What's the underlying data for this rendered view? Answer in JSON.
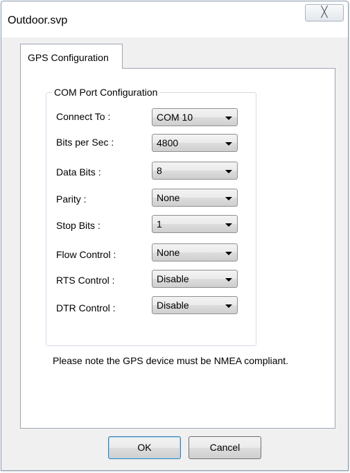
{
  "window": {
    "title": "Outdoor.svp",
    "close_glyph": "╳"
  },
  "tabs": [
    {
      "label": "GPS Configuration",
      "active": true
    }
  ],
  "group": {
    "title": "COM Port Configuration",
    "rows": [
      {
        "label": "Connect To :",
        "value": "COM 10"
      },
      {
        "label": "Bits per Sec :",
        "value": "4800"
      },
      {
        "label": "Data Bits :",
        "value": "8"
      },
      {
        "label": "Parity :",
        "value": "None"
      },
      {
        "label": "Stop Bits :",
        "value": "1"
      },
      {
        "label": "Flow Control :",
        "value": "None"
      },
      {
        "label": "RTS Control :",
        "value": "Disable"
      },
      {
        "label": "DTR Control :",
        "value": "Disable"
      }
    ]
  },
  "note": "Please note the GPS  device must be NMEA compliant.",
  "buttons": {
    "ok": "OK",
    "cancel": "Cancel"
  },
  "icons": {
    "dropdown": "chevron-down-icon",
    "close": "close-icon"
  }
}
